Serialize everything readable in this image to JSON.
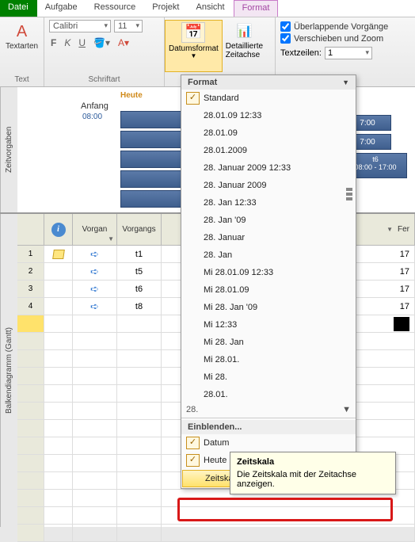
{
  "tabs": {
    "file": "Datei",
    "aufgabe": "Aufgabe",
    "ressource": "Ressource",
    "projekt": "Projekt",
    "ansicht": "Ansicht",
    "format": "Format"
  },
  "ribbon": {
    "textarten": "Textarten",
    "text_group": "Text",
    "schriftart_group": "Schriftart",
    "font_name": "Calibri",
    "font_size": "11",
    "datumsformat": "Datumsformat",
    "detaillierte": "Detaillierte\nZeitachse",
    "format_group": "Format",
    "overlap": "Überlappende Vorgänge",
    "verschieben": "Verschieben und Zoom",
    "textzeilen_label": "Textzeilen:",
    "textzeilen_value": "1"
  },
  "timeline": {
    "side_label": "Zeitvorgaben",
    "heute": "Heute",
    "anfang": "Anfang",
    "anfang_time": "08:00",
    "r1": "7:00",
    "r2": "7:00",
    "t6_label": "t6",
    "t6_times": "08:00 - 17:00"
  },
  "grid": {
    "side_label": "Balkendiagramm (Gantt)",
    "header": {
      "vorgan": "Vorgan",
      "vorgangsname": "Vorgangs",
      "fer": "Fer"
    },
    "rows": [
      {
        "n": "1",
        "name": "t1",
        "f": "17"
      },
      {
        "n": "2",
        "name": "t5",
        "f": "17"
      },
      {
        "n": "3",
        "name": "t6",
        "f": "17"
      },
      {
        "n": "4",
        "name": "t8",
        "f": "17"
      }
    ]
  },
  "dropdown": {
    "title": "Format",
    "items": [
      "Standard",
      "28.01.09 12:33",
      "28.01.09",
      "28.01.2009",
      "28. Januar 2009 12:33",
      "28. Januar 2009",
      "28. Jan 12:33",
      "28. Jan '09",
      "28. Januar",
      "28. Jan",
      "Mi 28.01.09 12:33",
      "Mi 28.01.09",
      "Mi 28. Jan '09",
      "Mi 12:33",
      "Mi 28. Jan",
      "Mi 28.01.",
      "Mi 28.",
      "28.01.",
      "28."
    ],
    "section": "Einblenden...",
    "datum": "Datum",
    "heute": "Heute",
    "zeitskala": "Zeitskala"
  },
  "tooltip": {
    "title": "Zeitskala",
    "body": "Die Zeitskala mit der Zeitachse anzeigen."
  }
}
